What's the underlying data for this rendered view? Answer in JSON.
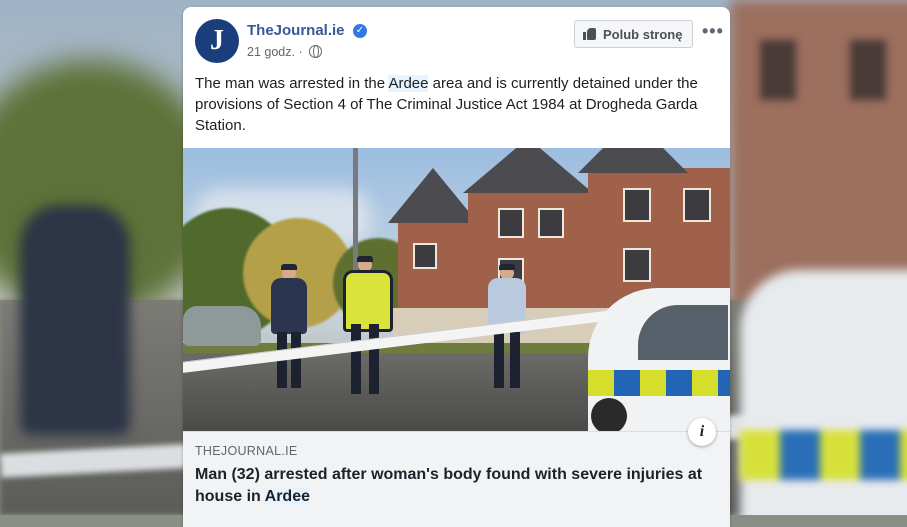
{
  "post": {
    "page_name": "TheJournal.ie",
    "avatar_letter": "J",
    "time": "21 godz.",
    "like_page_label": "Polub stronę",
    "more_label": "•••",
    "text_before": "The man was arrested in the ",
    "text_highlight": "Ardee",
    "text_after": " area and is currently detained under the provisions of Section 4 of The Criminal Justice Act 1984 at Drogheda Garda Station."
  },
  "link_preview": {
    "domain": "THEJOURNAL.IE",
    "headline_before": "Man (32) arrested after woman's body found with severe injuries at house in ",
    "headline_highlight": "Ardee",
    "info_label": "i"
  },
  "icons": {
    "verified": "verified-badge-icon",
    "globe": "globe-icon",
    "like": "thumbs-up-icon",
    "info": "info-icon"
  },
  "colors": {
    "page_name": "#385898",
    "verified": "#3578e5",
    "highlight": "#e7f3ff",
    "avatar": "#1a3e7c"
  }
}
